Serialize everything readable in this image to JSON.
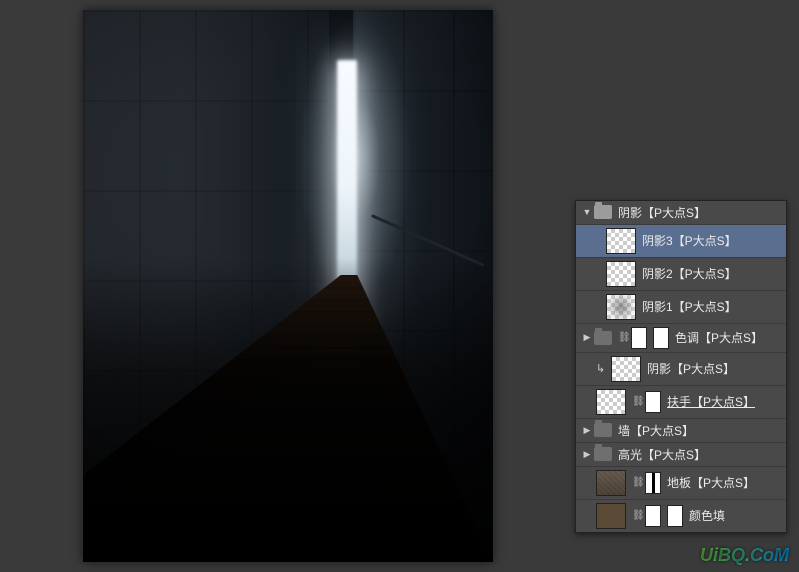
{
  "group": {
    "name": "阴影【P大点S】"
  },
  "group_children": [
    {
      "label": "阴影3【P大点S】",
      "selected": true,
      "thumb": "transparent"
    },
    {
      "label": "阴影2【P大点S】",
      "selected": false,
      "thumb": "transparent"
    },
    {
      "label": "阴影1【P大点S】",
      "selected": false,
      "thumb": "blurred"
    }
  ],
  "siblings": [
    {
      "type": "group_adj",
      "label": "色调【P大点S】"
    },
    {
      "type": "clipped",
      "label": "阴影【P大点S】"
    },
    {
      "type": "masked",
      "label": "扶手【P大点S】",
      "underline": true
    },
    {
      "type": "group",
      "label": "墙【P大点S】"
    },
    {
      "type": "group",
      "label": "高光【P大点S】"
    },
    {
      "type": "masked_img",
      "label": "地板【P大点S】"
    },
    {
      "type": "fill_adj",
      "label": "颜色填"
    }
  ],
  "watermark": "UiBQ.CoM"
}
